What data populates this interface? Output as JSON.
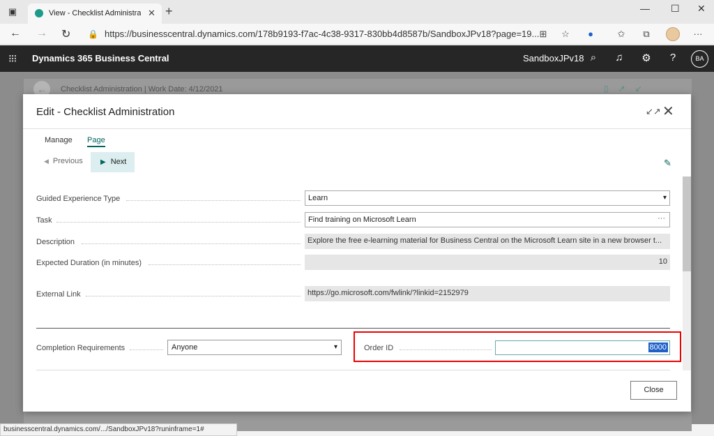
{
  "browser": {
    "tab_title": "View - Checklist Administration -",
    "url": "https://businesscentral.dynamics.com/178b9193-f7ac-4c38-9317-830bb4d8587b/SandboxJPv18?page=19...",
    "status_url": "businesscentral.dynamics.com/.../SandboxJPv18?runinframe=1#"
  },
  "app": {
    "title": "Dynamics 365 Business Central",
    "environment": "SandboxJPv18",
    "user_initials": "BA"
  },
  "background_page": {
    "title": "Checklist Administration | Work Date: 4/12/2021"
  },
  "dialog": {
    "title": "Edit - Checklist Administration",
    "menu": [
      "Manage",
      "Page"
    ],
    "active_menu": "Page",
    "previous_label": "Previous",
    "next_label": "Next",
    "fields": {
      "guided_type": {
        "label": "Guided Experience Type",
        "value": "Learn"
      },
      "task": {
        "label": "Task",
        "value": "Find training on Microsoft Learn"
      },
      "description": {
        "label": "Description",
        "value": "Explore the free e-learning material for Business Central on the Microsoft Learn site in a new browser t..."
      },
      "duration": {
        "label": "Expected Duration (in minutes)",
        "value": "10"
      },
      "external_link": {
        "label": "External Link",
        "value": "https://go.microsoft.com/fwlink/?linkid=2152979"
      },
      "completion": {
        "label": "Completion Requirements",
        "value": "Anyone"
      },
      "order_id": {
        "label": "Order ID",
        "value": "8000"
      }
    },
    "close_label": "Close"
  },
  "colors": {
    "accent": "#00665e",
    "highlight_box": "#e00000",
    "header_bg": "#262626"
  }
}
